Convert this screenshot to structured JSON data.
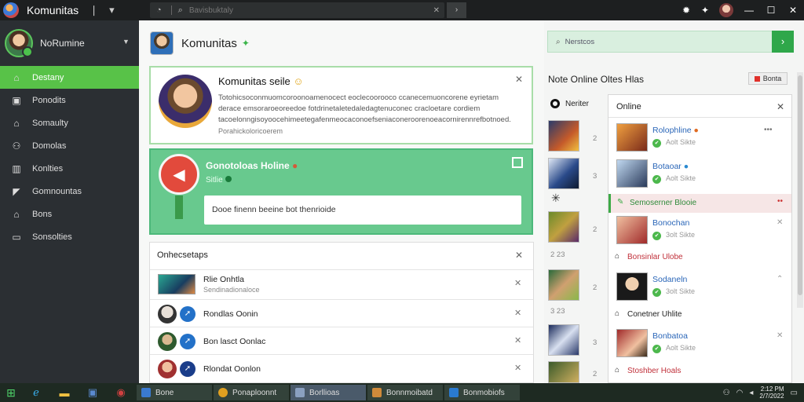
{
  "titlebar": {
    "app_title": "Komunitas",
    "search_placeholder": "Bavisbuktaly"
  },
  "sidebar": {
    "user_name": "NoRumine",
    "items": [
      {
        "label": "Destany",
        "icon": "home-icon"
      },
      {
        "label": "Ponodits",
        "icon": "briefcase-icon"
      },
      {
        "label": "Somaulty",
        "icon": "house-icon"
      },
      {
        "label": "Domolas",
        "icon": "people-icon"
      },
      {
        "label": "Konlties",
        "icon": "building-icon"
      },
      {
        "label": "Gomnountas",
        "icon": "megaphone-icon"
      },
      {
        "label": "Bons",
        "icon": "house-icon"
      },
      {
        "label": "Sonsolties",
        "icon": "monitor-icon"
      }
    ]
  },
  "main": {
    "title": "Komunitas",
    "card1": {
      "heading": "Komunitas seile",
      "body": "Totohicsoconmuomcoroonoamenocect eoclecoorooco ccanecemuoncorene eyrietam derace emsoraroeoreedoe fotdrinetaletedaledagtenuconec cracloetare cordiem tacoelonngisoyoocehimeetegafenmeocaconoefseniaconeroorenoeacornirennrefbotnoed.",
      "meta": "Porahickoloricoerem"
    },
    "card2": {
      "heading": "Gonotoloas Holine",
      "sub": "Sitlie",
      "field": "Dooe finenn beeine bot thenrioide"
    },
    "card3": {
      "heading": "Onhecsetaps",
      "rows": [
        {
          "title": "Rlie Onhtla",
          "sub": "Sendinadionaloce"
        },
        {
          "title": "Rondlas Oonin"
        },
        {
          "title": "Bon lasct Oonlac"
        },
        {
          "title": "Rlondat Oonlon"
        }
      ]
    }
  },
  "right": {
    "notice": "Nerstcos",
    "title": "Note Online Oltes Hlas",
    "badge": "Bonta",
    "col_header": "Neriter",
    "strip_numbers": [
      "2",
      "3",
      "2",
      "2 23",
      "2",
      "3 23",
      "3",
      "2"
    ],
    "online": {
      "title": "Online",
      "friends": [
        {
          "name": "Rolophline",
          "status": "Aolt Sikte"
        },
        {
          "name": "Botaoar",
          "status": "Aolt Sikte"
        },
        {
          "name": "Bonochan",
          "status": "3olt Sikte"
        },
        {
          "name": "Sodaneln",
          "status": "3olt Sikte"
        },
        {
          "name": "Bonbatoa",
          "status": "Aolt Sikte"
        }
      ],
      "bars": [
        "Semoserner Blooie",
        "Bonsinlar Ulobe",
        "Conetner Uhlite",
        "Stoshber Hoals"
      ]
    }
  },
  "taskbar": {
    "tasks": [
      "Bone",
      "Ponaploonnt",
      "Borllioas",
      "Bonnmoibatd",
      "Bonmobiofs"
    ],
    "clock_time": "2:12 PM",
    "clock_date": "2/7/2022"
  }
}
